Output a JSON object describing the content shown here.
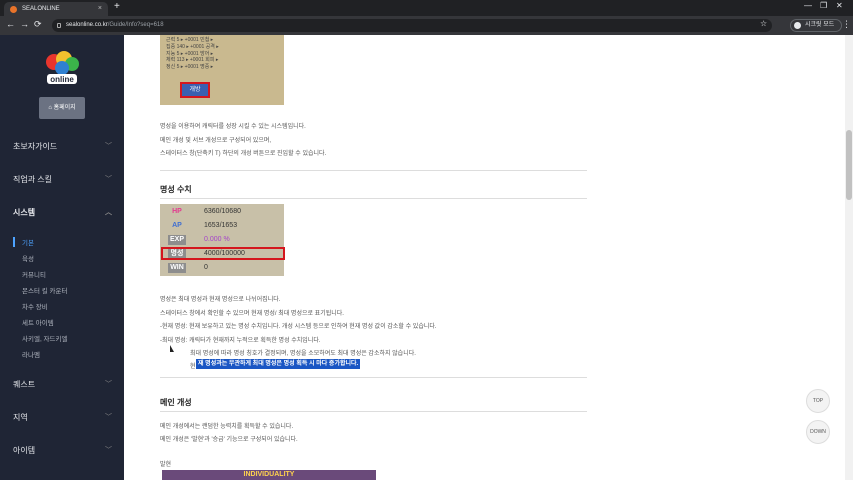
{
  "browser": {
    "tab_title": "SEALONLINE",
    "tab_close": "×",
    "new_tab": "+",
    "url_host": "sealonline.co.kr",
    "url_path": "/Guide/Info?seq=618",
    "profile_label": "시크릿 모드",
    "back": "←",
    "forward": "→",
    "reload": "⟳",
    "bookmark_star": "☆",
    "menu": "⋮",
    "win_min": "—",
    "win_restore": "❐",
    "win_close": "✕"
  },
  "sidebar": {
    "logo_text": "online",
    "home_button": "⌂ 홈페이지",
    "items": [
      {
        "label": "초보자가이드",
        "chev": "﹀"
      },
      {
        "label": "직업과 스킬",
        "chev": "﹀"
      },
      {
        "label": "시스템",
        "chev": "︿"
      },
      {
        "label": "퀘스트",
        "chev": "﹀"
      },
      {
        "label": "지역",
        "chev": "﹀"
      },
      {
        "label": "아이템",
        "chev": "﹀"
      }
    ],
    "subitems": [
      "기본",
      "육성",
      "커뮤니티",
      "몬스터 킬 카운터",
      "차수 장비",
      "세트 아이템",
      "사키엘, 자드키엘",
      "라나멤"
    ]
  },
  "content": {
    "game1_lines": [
      "근력 5 ▸ +0001 민첩 ▸",
      "집중 140 ▸ +0001 공격 ▸",
      "지능 5 ▸ +0001 방어 ▸",
      "체력 113 ▸ +0001 회피 ▸",
      "정신 5 ▸ +0001 명중 ▸"
    ],
    "game1_button": "개방",
    "intro": [
      "명성을 이용하여 캐릭터를 성장 시킬 수 있는 시스템입니다.",
      "메인 개성 및 서브 개성으로 구성되어 있으며,",
      "스테이터스 창(단축키 T) 하단의 개성 버튼으로 진입할 수 있습니다."
    ],
    "section1_title": "명성 수치",
    "stats": [
      {
        "label": "HP",
        "value": "6360/10680",
        "color": "#e23b8f"
      },
      {
        "label": "AP",
        "value": "1653/1653",
        "color": "#3f6fd1"
      },
      {
        "label": "EXP",
        "value": "0.000 %",
        "color": "#a545c9"
      },
      {
        "label": "명성",
        "value": "4000/100000",
        "color": "#555555"
      },
      {
        "label": "WIN",
        "value": "0",
        "color": "#555555"
      }
    ],
    "fame_paragraphs": [
      "명성은 최대 명성과 현재 명성으로 나뉘어집니다.",
      "스테이터스 창에서 확인할 수 있으며 현재 명성/ 최대 명성으로 표기됩니다.",
      "-현재 명성: 현재 보유하고 있는 명성 수치입니다. 개성 시스템 등으로 인하여 현재 명성 값이 감소할 수 있습니다.",
      "-최대 명성: 캐릭터가 현재까지 누적으로 획득한 명성 수치입니다.",
      "최대 명성에 따라 명성 칭호가 결정되며, 명성을 소모하여도 최대 명성은 감소하지 않습니다.",
      "현"
    ],
    "highlight": "재 명성과는 무관하게 최대 명성은 명성 획득 시 마다 증가합니다.",
    "section2_title": "메인 개성",
    "main_paragraphs": [
      "메인 개성에서는 랜덤한 능력치를 획득할 수 있습니다.",
      "메인 개성은 '발현'과 '승급' 기능으로 구성되어 있습니다."
    ],
    "sub_heading": "발현",
    "banner": "INDIVIDUALITY"
  },
  "float_buttons": {
    "top": "TOP",
    "down": "DOWN"
  }
}
